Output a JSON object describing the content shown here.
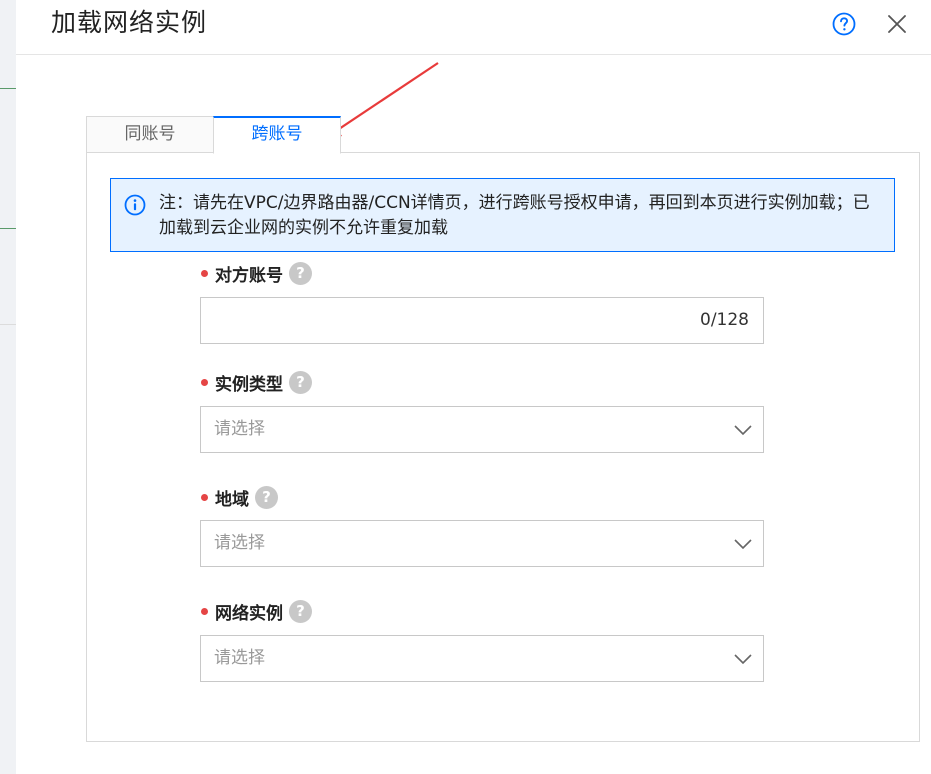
{
  "dialog": {
    "title": "加载网络实例",
    "help_icon": "help-circle-icon",
    "close_icon": "close-icon"
  },
  "tabs": [
    {
      "label": "同账号",
      "active": false
    },
    {
      "label": "跨账号",
      "active": true
    }
  ],
  "notice": {
    "icon": "info-circle-icon",
    "text": "注：请先在VPC/边界路由器/CCN详情页，进行跨账号授权申请，再回到本页进行实例加载；已加载到云企业网的实例不允许重复加载"
  },
  "form": {
    "account": {
      "label": "对方账号",
      "help": "?",
      "value": "",
      "counter": "0/128"
    },
    "instance_type": {
      "label": "实例类型",
      "help": "?",
      "placeholder": "请选择"
    },
    "region": {
      "label": "地域",
      "help": "?",
      "placeholder": "请选择"
    },
    "network_instance": {
      "label": "网络实例",
      "help": "?",
      "placeholder": "请选择"
    }
  },
  "colors": {
    "accent": "#006eff",
    "notice_bg": "#e6f2ff",
    "required": "#e54545",
    "annotation_arrow": "#e83b3b"
  }
}
